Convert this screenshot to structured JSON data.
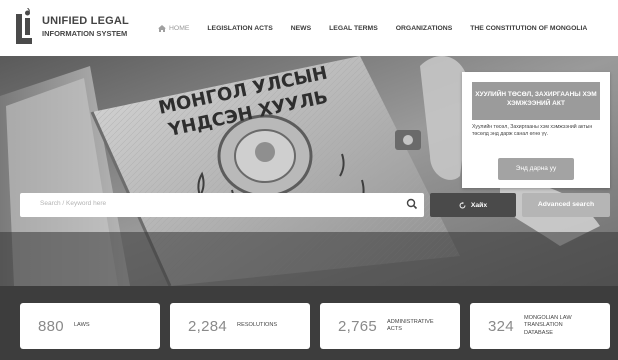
{
  "logo": {
    "line1": "UNIFIED LEGAL",
    "line2": "INFORMATION SYSTEM",
    "mark_icon": "li-logo-mark"
  },
  "nav": {
    "items": [
      {
        "label": "HOME",
        "icon": "home-icon"
      },
      {
        "label": "LEGISLATION ACTS"
      },
      {
        "label": "NEWS"
      },
      {
        "label": "LEGAL TERMS"
      },
      {
        "label": "ORGANIZATIONS"
      },
      {
        "label": "THE CONSTITUTION OF MONGOLIA"
      }
    ]
  },
  "hero": {
    "book_title_line1": "МОНГОЛ УЛСЫН",
    "book_title_line2": "ҮНДСЭН ХУУЛЬ"
  },
  "promo": {
    "title": "ХУУЛИЙН ТӨСӨЛ, ЗАХИРГААНЫ ХЭМ ХЭМЖЭЭНИЙ АКТ",
    "description": "Хуулийн төсөл, Захиргааны хэм хэмжээний актын төсөлд энд дарж санал өгнө үү.",
    "button_label": "Энд дарна уу"
  },
  "search": {
    "placeholder": "Search / Keyword here",
    "button_label": "Хайх",
    "advanced_label": "Advanced search"
  },
  "stats": [
    {
      "value": "880",
      "label": "LAWS"
    },
    {
      "value": "2,284",
      "label": "RESOLUTIONS"
    },
    {
      "value": "2,765",
      "label": "ADMINISTRATIVE ACTS"
    },
    {
      "value": "324",
      "label": "MONGOLIAN LAW TRANSLATION DATABASE"
    }
  ],
  "colors": {
    "stats_band": "#3d3d3d",
    "search_button": "#4a4a4a",
    "advanced_button": "#b5b5b5",
    "promo_title_bg": "#9b9b9b"
  }
}
